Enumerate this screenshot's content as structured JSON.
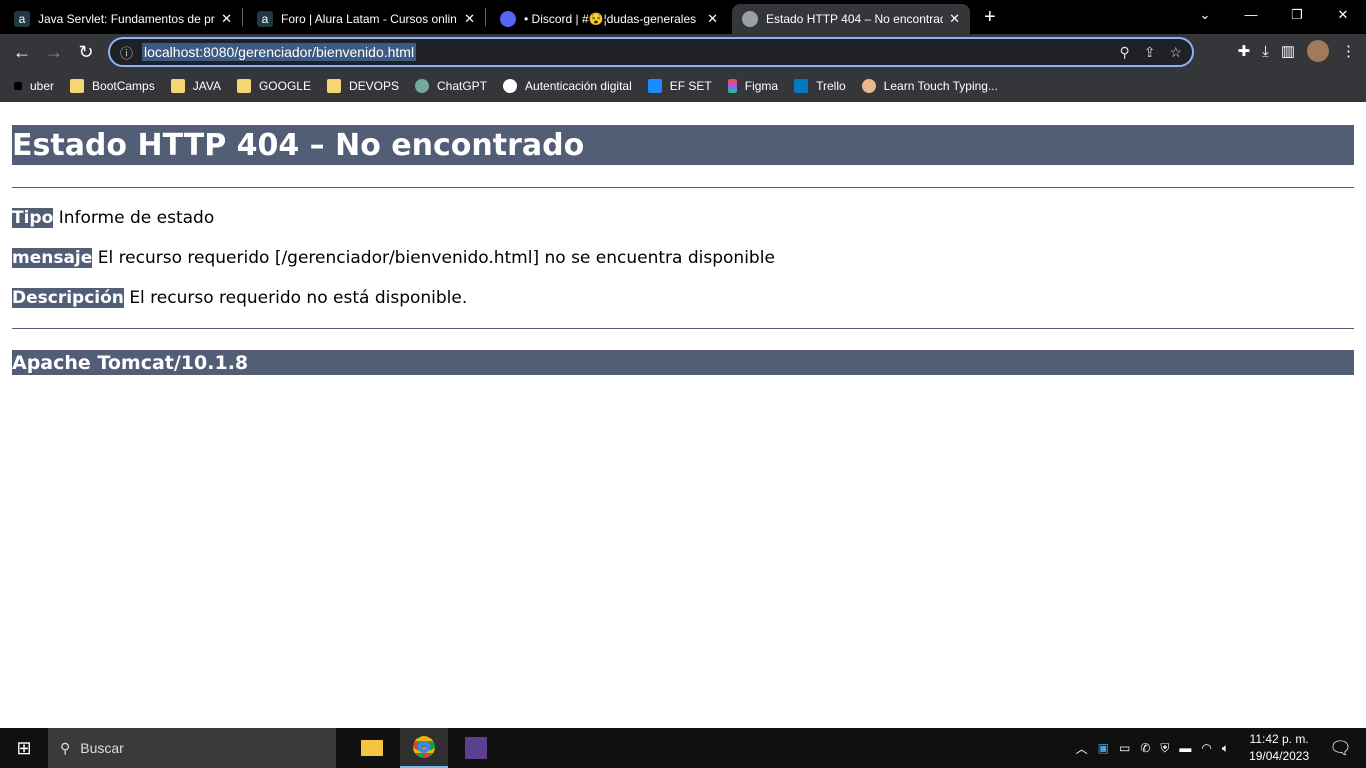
{
  "browser": {
    "tabs": [
      {
        "title": "Java Servlet: Fundamentos de pro",
        "icon": "alura-icon",
        "active": false
      },
      {
        "title": "Foro | Alura Latam - Cursos onlin",
        "icon": "alura-icon",
        "active": false
      },
      {
        "title": "• Discord | #😵¦dudas-generales",
        "icon": "discord-icon",
        "active": false
      },
      {
        "title": "Estado HTTP 404 – No encontrad",
        "icon": "globe-icon",
        "active": true
      }
    ],
    "url": "localhost:8080/gerenciador/bienvenido.html",
    "bookmarks": [
      {
        "label": "uber",
        "icon": "uber-icon"
      },
      {
        "label": "BootCamps",
        "icon": "folder-icon"
      },
      {
        "label": "JAVA",
        "icon": "folder-icon"
      },
      {
        "label": "GOOGLE",
        "icon": "folder-icon"
      },
      {
        "label": "DEVOPS",
        "icon": "folder-icon"
      },
      {
        "label": "ChatGPT",
        "icon": "chatgpt-icon"
      },
      {
        "label": "Autenticación digital",
        "icon": "globe-icon"
      },
      {
        "label": "EF SET",
        "icon": "efset-icon"
      },
      {
        "label": "Figma",
        "icon": "figma-icon"
      },
      {
        "label": "Trello",
        "icon": "trello-icon"
      },
      {
        "label": "Learn Touch Typing...",
        "icon": "typing-icon"
      }
    ]
  },
  "page": {
    "title": "Estado HTTP 404 – No encontrado",
    "rows": [
      {
        "label": "Tipo",
        "text": "Informe de estado"
      },
      {
        "label": "mensaje",
        "text": "El recurso requerido [/gerenciador/bienvenido.html] no se encuentra disponible"
      },
      {
        "label": "Descripción",
        "text": "El recurso requerido no está disponible."
      }
    ],
    "footer": "Apache Tomcat/10.1.8",
    "accent": "#525D76"
  },
  "taskbar": {
    "search_placeholder": "Buscar",
    "time": "11:42 p. m.",
    "date": "19/04/2023"
  }
}
